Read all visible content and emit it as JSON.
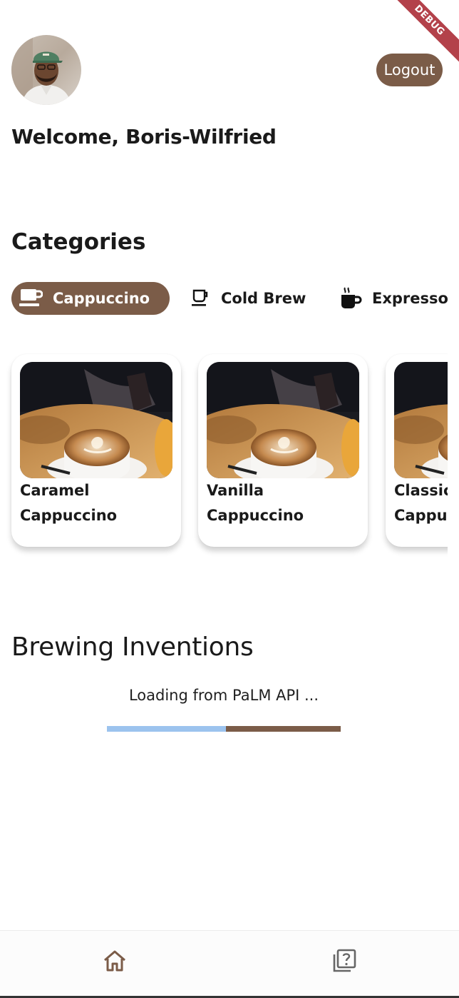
{
  "debug_banner": "DEBUG",
  "header": {
    "logout_label": "Logout",
    "welcome": "Welcome, Boris-Wilfried",
    "avatar": "user-avatar"
  },
  "categories": {
    "title": "Categories",
    "items": [
      {
        "label": "Cappuccino",
        "icon": "cup-icon",
        "selected": true
      },
      {
        "label": "Cold Brew",
        "icon": "cold-brew-cup-icon",
        "selected": false
      },
      {
        "label": "Expresso",
        "icon": "steaming-mug-icon",
        "selected": false
      }
    ]
  },
  "products": [
    {
      "line1": "Caramel",
      "line2": "Cappuccino"
    },
    {
      "line1": "Vanilla",
      "line2": "Cappuccino"
    },
    {
      "line1": "Classic",
      "line2": "Cappuccino"
    }
  ],
  "brewing": {
    "title": "Brewing Inventions",
    "loading_text": "Loading from PaLM API ...",
    "progress": 0.51
  },
  "bottom_nav": {
    "items": [
      {
        "icon": "home-icon",
        "active": true
      },
      {
        "icon": "quiz-icon",
        "active": false
      }
    ]
  },
  "colors": {
    "accent": "#7b5c48",
    "progress_light": "#9cc3ee",
    "debug_ribbon": "#b3414a"
  }
}
